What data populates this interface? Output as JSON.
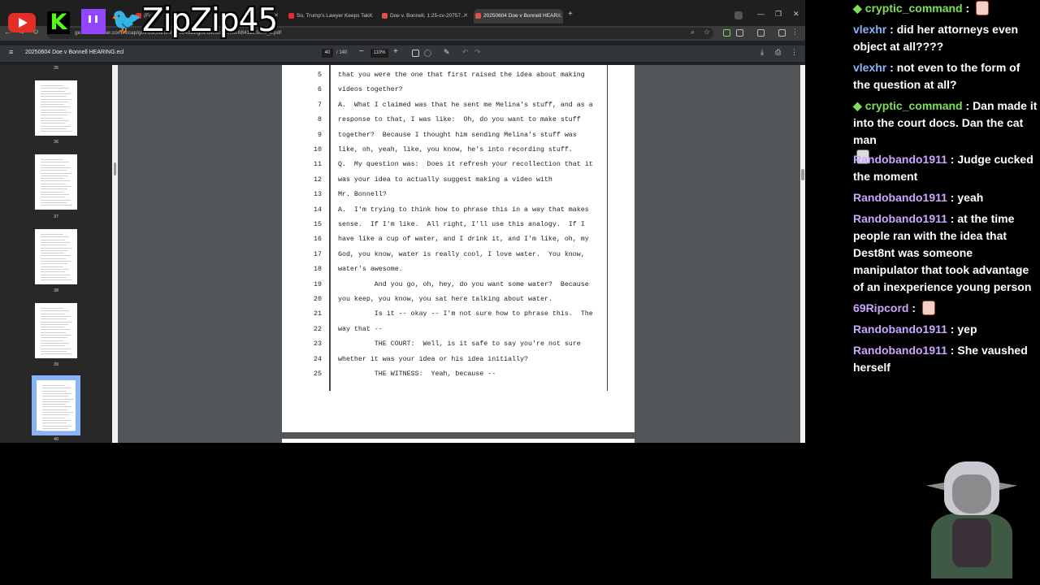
{
  "overlay": {
    "handle": "ZipZip45",
    "icons": [
      "youtube-icon",
      "kick-icon",
      "twitch-icon",
      "twitter-icon"
    ]
  },
  "browser": {
    "tabs": [
      {
        "label": "(Full...",
        "active": false
      },
      {
        "label": "So, Trump's Lawyer Keeps Tak...",
        "active": false
      },
      {
        "label": "Doe v. Bonnell, 1:25-cv-20757...",
        "active": false
      },
      {
        "label": "20250604 Doe v Bonnell HEAR...",
        "active": true
      }
    ],
    "new_tab_label": "+",
    "url": "ge.courtlistener.com/recap/gov.uscourts.flsd.684111/gov.uscourts.flsd.684111.90.0_3.pdf"
  },
  "pdf": {
    "filename": "20250604 Doe v Bonnell HEARING.ecl",
    "current_page": "40",
    "total_pages": "/ 140",
    "zoom": "110%",
    "thumbnails": [
      {
        "label": "35",
        "selected": false
      },
      {
        "label": "36",
        "selected": false
      },
      {
        "label": "37",
        "selected": false
      },
      {
        "label": "38",
        "selected": false
      },
      {
        "label": "39",
        "selected": false
      },
      {
        "label": "40",
        "selected": true
      }
    ],
    "lines": [
      {
        "n": "5",
        "t": "that you were the one that first raised the idea about making"
      },
      {
        "n": "6",
        "t": "videos together?"
      },
      {
        "n": "7",
        "t": "A.  What I claimed was that he sent me Melina's stuff, and as a"
      },
      {
        "n": "8",
        "t": "response to that, I was like:  Oh, do you want to make stuff"
      },
      {
        "n": "9",
        "t": "together?  Because I thought him sending Melina's stuff was"
      },
      {
        "n": "10",
        "t": "like, oh, yeah, like, you know, he's into recording stuff."
      },
      {
        "n": "11",
        "t": "Q.  My question was:  Does it refresh your recollection that it"
      },
      {
        "n": "12",
        "t": "was your idea to actually suggest making a video with"
      },
      {
        "n": "13",
        "t": "Mr. Bonnell?"
      },
      {
        "n": "14",
        "t": "A.  I'm trying to think how to phrase this in a way that makes"
      },
      {
        "n": "15",
        "t": "sense.  If I'm like.  All right, I'll use this analogy.  If I"
      },
      {
        "n": "16",
        "t": "have like a cup of water, and I drink it, and I'm like, oh, my"
      },
      {
        "n": "17",
        "t": "God, you know, water is really cool, I love water.  You know,"
      },
      {
        "n": "18",
        "t": "water's awesome."
      },
      {
        "n": "19",
        "t": "         And you go, oh, hey, do you want some water?  Because"
      },
      {
        "n": "20",
        "t": "you keep, you know, you sat here talking about water."
      },
      {
        "n": "21",
        "t": "         Is it -- okay -- I'm not sure how to phrase this.  The"
      },
      {
        "n": "22",
        "t": "way that --"
      },
      {
        "n": "23",
        "t": "         THE COURT:  Well, is it safe to say you're not sure"
      },
      {
        "n": "24",
        "t": "whether it was your idea or his idea initially?"
      },
      {
        "n": "25",
        "t": "         THE WITNESS:  Yeah, because --"
      }
    ]
  },
  "chat": {
    "messages": [
      {
        "user": "cryptic_command",
        "sep": " : ",
        "text": "",
        "color": "#7ee05a",
        "badge": true,
        "emote": "face"
      },
      {
        "user": "vlexhr",
        "sep": " : ",
        "text": "did her attorneys even object at all????",
        "color": "#8ab4f8",
        "badge": false,
        "emote": ""
      },
      {
        "user": "vlexhr",
        "sep": " : ",
        "text": "not even to the form of the question at all?",
        "color": "#8ab4f8",
        "badge": false,
        "emote": ""
      },
      {
        "user": "cryptic_command",
        "sep": " : ",
        "text": "Dan made it into the court docs. Dan the cat man",
        "color": "#7ee05a",
        "badge": true,
        "emote": "cat"
      },
      {
        "user": "Randobando1911",
        "sep": " : ",
        "text": "Judge cucked the moment",
        "color": "#c9a6ff",
        "badge": false,
        "emote": ""
      },
      {
        "user": "Randobando1911",
        "sep": " : ",
        "text": "yeah",
        "color": "#c9a6ff",
        "badge": false,
        "emote": ""
      },
      {
        "user": "Randobando1911",
        "sep": " : ",
        "text": "at the time people ran with the idea that Dest8nt was someone manipulator that took advantage of an inexperience young person",
        "color": "#c9a6ff",
        "badge": false,
        "emote": ""
      },
      {
        "user": "69Ripcord",
        "sep": " : ",
        "text": "",
        "color": "#c9a6ff",
        "badge": false,
        "emote": "face"
      },
      {
        "user": "Randobando1911",
        "sep": " : ",
        "text": "yep",
        "color": "#c9a6ff",
        "badge": false,
        "emote": ""
      },
      {
        "user": "Randobando1911",
        "sep": " : ",
        "text": "She vaushed herself",
        "color": "#c9a6ff",
        "badge": false,
        "emote": ""
      }
    ]
  }
}
